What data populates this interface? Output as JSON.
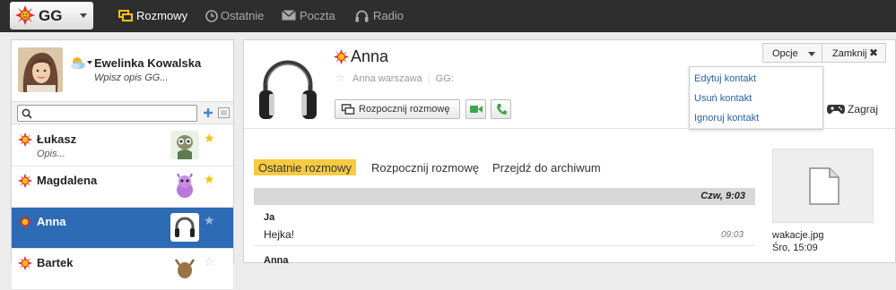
{
  "app": {
    "logo_text": "GG"
  },
  "nav": [
    {
      "label": "Rozmowy",
      "icon": "chat-icon",
      "active": true
    },
    {
      "label": "Ostatnie",
      "icon": "clock-icon",
      "active": false
    },
    {
      "label": "Poczta",
      "icon": "mail-icon",
      "active": false
    },
    {
      "label": "Radio",
      "icon": "headphones-icon",
      "active": false
    }
  ],
  "me": {
    "name": "Ewelinka Kowalska",
    "description": "Wpisz opis GG..."
  },
  "search": {
    "placeholder": ""
  },
  "contacts": [
    {
      "name": "Łukasz",
      "description": "Opis...",
      "selected": false,
      "favorite": true
    },
    {
      "name": "Magdalena",
      "description": "",
      "selected": false,
      "favorite": true
    },
    {
      "name": "Anna",
      "description": "",
      "selected": true,
      "favorite": false
    },
    {
      "name": "Bartek",
      "description": "",
      "selected": false,
      "favorite": false
    }
  ],
  "conversation": {
    "contact_name": "Anna",
    "contact_city": "Anna warszawa",
    "gg_label": "GG:",
    "start_button": "Rozpocznij rozmowę",
    "options_button": "Opcje",
    "close_button": "Zamknij",
    "options_menu": [
      "Edytuj kontakt",
      "Usuń kontakt",
      "Ignoruj kontakt"
    ],
    "game_link": "Zagraj",
    "tabs": [
      "Ostatnie rozmowy",
      "Rozpocznij rozmowę",
      "Przejdź do archiwum"
    ],
    "day_header": "Czw, 9:03",
    "messages": [
      {
        "author": "Ja",
        "text": "Hejka!",
        "time": "09:03"
      },
      {
        "author": "Anna",
        "text": "",
        "time": ""
      }
    ],
    "file": {
      "name": "wakacje.jpg",
      "date": "Śro, 15:09"
    }
  },
  "colors": {
    "accent_blue": "#2d6bb5",
    "tab_active": "#f6cb40",
    "topbar": "#2e2e2e",
    "link": "#2462a8"
  }
}
